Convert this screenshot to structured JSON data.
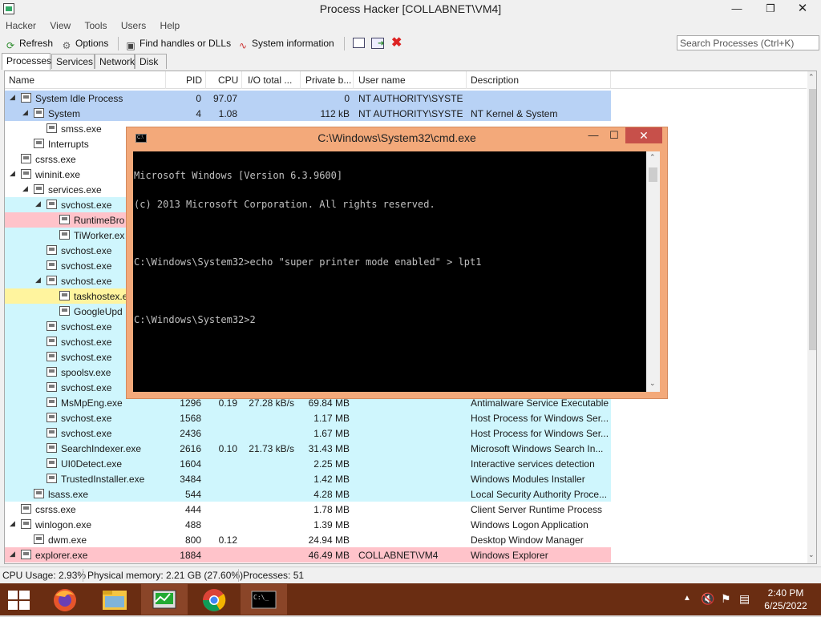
{
  "window": {
    "title": "Process Hacker [COLLABNET\\VM4]"
  },
  "menu": [
    "Hacker",
    "View",
    "Tools",
    "Users",
    "Help"
  ],
  "toolbar": {
    "refresh": "Refresh",
    "options": "Options",
    "find_handles": "Find handles or DLLs",
    "system_info": "System information"
  },
  "search": {
    "placeholder": "Search Processes (Ctrl+K)"
  },
  "tabs": [
    "Processes",
    "Services",
    "Network",
    "Disk"
  ],
  "columns": [
    "Name",
    "PID",
    "CPU",
    "I/O total ...",
    "Private b...",
    "User name",
    "Description"
  ],
  "rows": [
    {
      "name": "System Idle Process",
      "pid": "0",
      "cpu": "97.07",
      "io": "",
      "priv": "0",
      "user": "NT AUTHORITY\\SYSTEM",
      "desc": ""
    },
    {
      "name": "System",
      "pid": "4",
      "cpu": "1.08",
      "io": "",
      "priv": "112 kB",
      "user": "NT AUTHORITY\\SYSTEM",
      "desc": "NT Kernel & System"
    },
    {
      "name": "smss.exe",
      "pid": "",
      "cpu": "",
      "io": "",
      "priv": "",
      "user": "",
      "desc": ""
    },
    {
      "name": "Interrupts",
      "pid": "",
      "cpu": "",
      "io": "",
      "priv": "",
      "user": "",
      "desc": ""
    },
    {
      "name": "csrss.exe",
      "pid": "",
      "cpu": "",
      "io": "",
      "priv": "",
      "user": "",
      "desc": ""
    },
    {
      "name": "wininit.exe",
      "pid": "",
      "cpu": "",
      "io": "",
      "priv": "",
      "user": "",
      "desc": ""
    },
    {
      "name": "services.exe",
      "pid": "",
      "cpu": "",
      "io": "",
      "priv": "",
      "user": "",
      "desc": ""
    },
    {
      "name": "svchost.exe",
      "pid": "",
      "cpu": "",
      "io": "",
      "priv": "",
      "user": "",
      "desc": ""
    },
    {
      "name": "RuntimeBro",
      "pid": "",
      "cpu": "",
      "io": "",
      "priv": "",
      "user": "",
      "desc": ""
    },
    {
      "name": "TiWorker.ex",
      "pid": "",
      "cpu": "",
      "io": "",
      "priv": "",
      "user": "",
      "desc": ""
    },
    {
      "name": "svchost.exe",
      "pid": "",
      "cpu": "",
      "io": "",
      "priv": "",
      "user": "",
      "desc": ""
    },
    {
      "name": "svchost.exe",
      "pid": "",
      "cpu": "",
      "io": "",
      "priv": "",
      "user": "",
      "desc": ""
    },
    {
      "name": "svchost.exe",
      "pid": "",
      "cpu": "",
      "io": "",
      "priv": "",
      "user": "",
      "desc": ""
    },
    {
      "name": "taskhostex.e",
      "pid": "",
      "cpu": "",
      "io": "",
      "priv": "",
      "user": "",
      "desc": ""
    },
    {
      "name": "GoogleUpd",
      "pid": "",
      "cpu": "",
      "io": "",
      "priv": "",
      "user": "",
      "desc": ""
    },
    {
      "name": "svchost.exe",
      "pid": "",
      "cpu": "",
      "io": "",
      "priv": "",
      "user": "",
      "desc": ""
    },
    {
      "name": "svchost.exe",
      "pid": "",
      "cpu": "",
      "io": "",
      "priv": "",
      "user": "",
      "desc": ""
    },
    {
      "name": "svchost.exe",
      "pid": "",
      "cpu": "",
      "io": "",
      "priv": "",
      "user": "",
      "desc": ""
    },
    {
      "name": "spoolsv.exe",
      "pid": "",
      "cpu": "",
      "io": "",
      "priv": "",
      "user": "",
      "desc": ""
    },
    {
      "name": "svchost.exe",
      "pid": "",
      "cpu": "",
      "io": "",
      "priv": "",
      "user": "",
      "desc": ""
    },
    {
      "name": "MsMpEng.exe",
      "pid": "1296",
      "cpu": "0.19",
      "io": "27.28 kB/s",
      "priv": "69.84 MB",
      "user": "",
      "desc": "Antimalware Service Executable"
    },
    {
      "name": "svchost.exe",
      "pid": "1568",
      "cpu": "",
      "io": "",
      "priv": "1.17 MB",
      "user": "",
      "desc": "Host Process for Windows Ser..."
    },
    {
      "name": "svchost.exe",
      "pid": "2436",
      "cpu": "",
      "io": "",
      "priv": "1.67 MB",
      "user": "",
      "desc": "Host Process for Windows Ser..."
    },
    {
      "name": "SearchIndexer.exe",
      "pid": "2616",
      "cpu": "0.10",
      "io": "21.73 kB/s",
      "priv": "31.43 MB",
      "user": "",
      "desc": "Microsoft Windows Search In..."
    },
    {
      "name": "UI0Detect.exe",
      "pid": "1604",
      "cpu": "",
      "io": "",
      "priv": "2.25 MB",
      "user": "",
      "desc": "Interactive services detection"
    },
    {
      "name": "TrustedInstaller.exe",
      "pid": "3484",
      "cpu": "",
      "io": "",
      "priv": "1.42 MB",
      "user": "",
      "desc": "Windows Modules Installer"
    },
    {
      "name": "lsass.exe",
      "pid": "544",
      "cpu": "",
      "io": "",
      "priv": "4.28 MB",
      "user": "",
      "desc": "Local Security Authority Proce..."
    },
    {
      "name": "csrss.exe",
      "pid": "444",
      "cpu": "",
      "io": "",
      "priv": "1.78 MB",
      "user": "",
      "desc": "Client Server Runtime Process"
    },
    {
      "name": "winlogon.exe",
      "pid": "488",
      "cpu": "",
      "io": "",
      "priv": "1.39 MB",
      "user": "",
      "desc": "Windows Logon Application"
    },
    {
      "name": "dwm.exe",
      "pid": "800",
      "cpu": "0.12",
      "io": "",
      "priv": "24.94 MB",
      "user": "",
      "desc": "Desktop Window Manager"
    },
    {
      "name": "explorer.exe",
      "pid": "1884",
      "cpu": "",
      "io": "",
      "priv": "46.49 MB",
      "user": "COLLABNET\\VM4",
      "desc": "Windows Explorer"
    }
  ],
  "status": {
    "cpu": "CPU Usage: 2.93%",
    "memory": "Physical memory: 2.21 GB (27.60%)",
    "processes": "Processes: 51"
  },
  "cmd": {
    "title": "C:\\Windows\\System32\\cmd.exe",
    "lines": [
      "Microsoft Windows [Version 6.3.9600]",
      "(c) 2013 Microsoft Corporation. All rights reserved.",
      "",
      "C:\\Windows\\System32>echo \"super printer mode enabled\" > lpt1",
      "",
      "C:\\Windows\\System32>2"
    ]
  },
  "clock": {
    "time": "2:40 PM",
    "date": "6/25/2022"
  },
  "colors": {
    "system_row": "#b8d2f5",
    "service_row": "#cff6fd",
    "suspended_row": "#ffc3ca",
    "user_row": "#ffc3ca",
    "highlight_row": "#fff49e",
    "taskbar": "#6a2d12",
    "cmd_frame": "#f3a97a"
  }
}
